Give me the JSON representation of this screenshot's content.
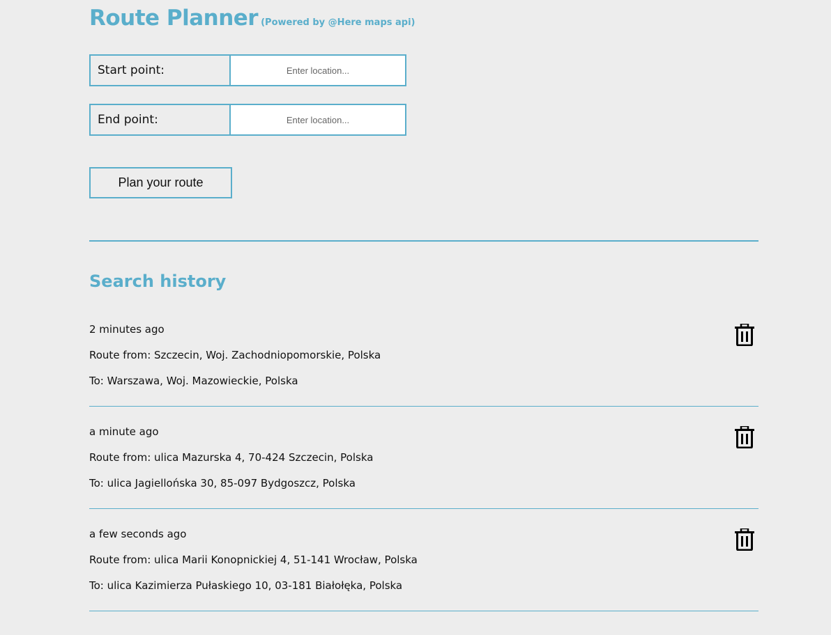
{
  "header": {
    "title": "Route Planner",
    "subtitle": "(Powered by @Here maps api)"
  },
  "form": {
    "start": {
      "label": "Start point:",
      "placeholder": "Enter location...",
      "value": ""
    },
    "end": {
      "label": "End point:",
      "placeholder": "Enter location...",
      "value": ""
    },
    "submit_label": "Plan your route"
  },
  "history": {
    "title": "Search history",
    "items": [
      {
        "time": "2 minutes ago",
        "from": "Route from: Szczecin, Woj. Zachodniopomorskie, Polska",
        "to": "To: Warszawa, Woj. Mazowieckie, Polska"
      },
      {
        "time": "a minute ago",
        "from": "Route from: ulica Mazurska 4, 70-424 Szczecin, Polska",
        "to": "To: ulica Jagiellońska 30, 85-097 Bydgoszcz, Polska"
      },
      {
        "time": "a few seconds ago",
        "from": "Route from: ulica Marii Konopnickiej 4, 51-141 Wrocław, Polska",
        "to": "To: ulica Kazimierza Pułaskiego 10, 03-181 Białołęka, Polska"
      }
    ],
    "delete_icon": "trash-icon"
  },
  "colors": {
    "accent": "#5aaecb",
    "background": "#ededed"
  }
}
